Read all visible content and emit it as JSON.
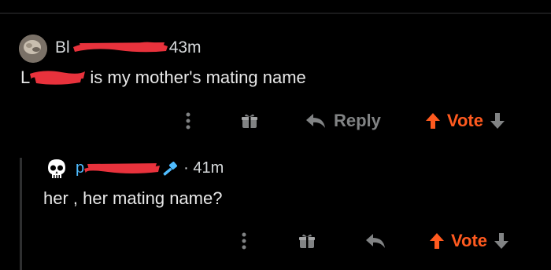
{
  "comment1": {
    "username_visible": "Bl",
    "time": "43m",
    "text_redacted_part": "L",
    "text": " is my mother's mating name",
    "actions": {
      "reply_label": "Reply",
      "vote_label": "Vote"
    }
  },
  "comment2": {
    "username_visible": "p",
    "time": "41m",
    "text": "her , her mating name?",
    "actions": {
      "vote_label": "Vote"
    }
  },
  "colors": {
    "background": "#000000",
    "text": "#e8e8e8",
    "muted": "#818384",
    "vote_accent": "#ff5a1f",
    "username_blue": "#4fbcff",
    "redaction_red": "#e8323c"
  },
  "icons": {
    "more": "vertical-dots-icon",
    "gift": "gift-icon",
    "reply": "reply-arrow-icon",
    "upvote": "upvote-arrow-icon",
    "downvote": "downvote-arrow-icon",
    "skull_avatar": "skull-avatar-icon",
    "mod_hammer": "moderator-hammer-icon"
  }
}
